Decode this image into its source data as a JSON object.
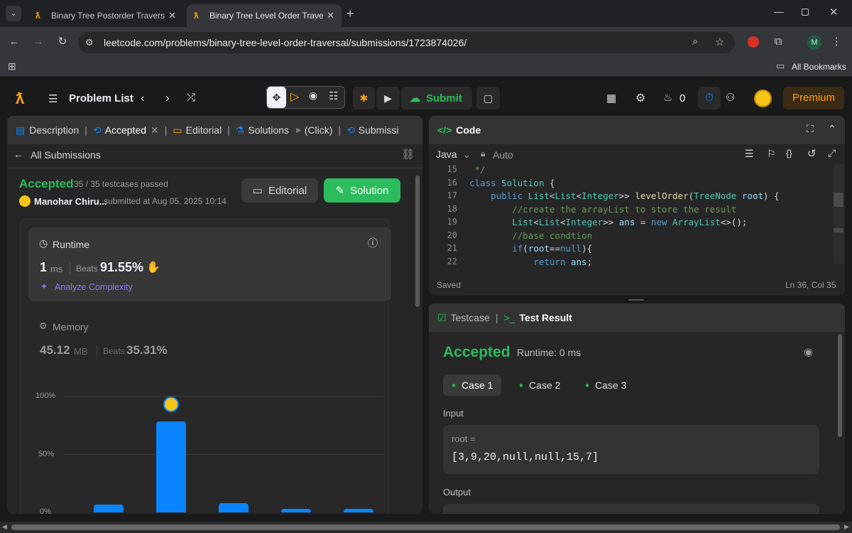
{
  "browser": {
    "tabs": [
      {
        "title": "Binary Tree Postorder Traversal",
        "active": false
      },
      {
        "title": "Binary Tree Level Order Traversal",
        "active": true
      }
    ],
    "url": "leetcode.com/problems/binary-tree-level-order-traversal/submissions/1723874026/",
    "bookmarks_label": "All Bookmarks",
    "profile_initial": "M"
  },
  "header": {
    "problem_list": "Problem List",
    "submit": "Submit",
    "streak": "0",
    "premium": "Premium"
  },
  "left": {
    "tabs": [
      "Description",
      "Accepted",
      "Editorial",
      "Solutions",
      "(Click)",
      "Submissi"
    ],
    "all_submissions": "All Submissions",
    "status": "Accepted",
    "testcases": "35 / 35 testcases passed",
    "user": "Manohar Chiru...",
    "submitted": "submitted at Aug 05, 2025 10:14",
    "editorial_btn": "Editorial",
    "solution_btn": "Solution",
    "runtime": {
      "label": "Runtime",
      "value": "1",
      "unit": "ms",
      "beats_label": "Beats",
      "beats": "91.55%",
      "analyze": "Analyze Complexity"
    },
    "memory": {
      "label": "Memory",
      "value": "45.12",
      "unit": "MB",
      "beats_label": "Beats",
      "beats": "35.31%"
    }
  },
  "chart_data": {
    "type": "bar",
    "yticks": [
      "100%",
      "50%",
      "0%"
    ],
    "ylim": [
      0,
      100
    ],
    "values": [
      7,
      78,
      8,
      3,
      3
    ],
    "highlight_index": 1,
    "color": "#0a84ff"
  },
  "code": {
    "title": "Code",
    "language": "Java",
    "mode": "Auto",
    "lines": [
      {
        "n": "15",
        "html": "<span class='cm'> */</span>"
      },
      {
        "n": "16",
        "html": "<span class='kw'>class</span> <span class='ty'>Solution</span> {"
      },
      {
        "n": "17",
        "html": "    <span class='kw'>public</span> <span class='ty'>List</span>&lt;<span class='ty'>List</span>&lt;<span class='ty'>Integer</span>&gt;&gt; <span class='fn'>levelOrder</span>(<span class='ty'>TreeNode</span> <span class='pr'>root</span>) {"
      },
      {
        "n": "18",
        "html": "        <span class='cm'>//create the arrayList to store the result</span>"
      },
      {
        "n": "19",
        "html": "        <span class='ty'>List</span>&lt;<span class='ty'>List</span>&lt;<span class='ty'>Integer</span>&gt;&gt; <span class='pr'>ans</span> = <span class='kw'>new</span> <span class='ty'>ArrayList</span>&lt;&gt;();"
      },
      {
        "n": "20",
        "html": "        <span class='cm'>//base condtion</span>"
      },
      {
        "n": "21",
        "html": "        <span class='kw'>if</span>(<span class='pr'>root</span>==<span class='kw'>null</span>){"
      },
      {
        "n": "22",
        "html": "            <span class='kw'>return</span> <span class='pr'>ans</span>;"
      }
    ],
    "saved": "Saved",
    "cursor": "Ln 36, Col 35"
  },
  "testpanel": {
    "tab_testcase": "Testcase",
    "tab_result": "Test Result",
    "status": "Accepted",
    "runtime": "Runtime: 0 ms",
    "cases": [
      "Case 1",
      "Case 2",
      "Case 3"
    ],
    "input_label": "Input",
    "var_name": "root =",
    "var_value": "[3,9,20,null,null,15,7]",
    "output_label": "Output"
  }
}
